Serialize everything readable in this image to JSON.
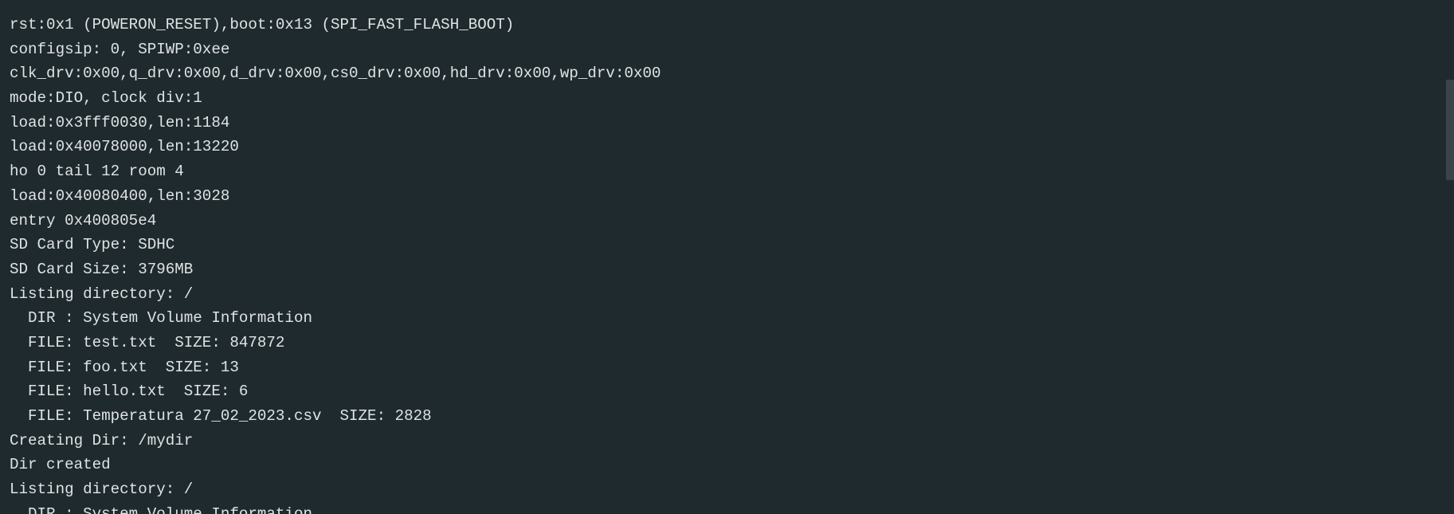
{
  "serial_monitor": {
    "lines": [
      "rst:0x1 (POWERON_RESET),boot:0x13 (SPI_FAST_FLASH_BOOT)",
      "configsip: 0, SPIWP:0xee",
      "clk_drv:0x00,q_drv:0x00,d_drv:0x00,cs0_drv:0x00,hd_drv:0x00,wp_drv:0x00",
      "mode:DIO, clock div:1",
      "load:0x3fff0030,len:1184",
      "load:0x40078000,len:13220",
      "ho 0 tail 12 room 4",
      "load:0x40080400,len:3028",
      "entry 0x400805e4",
      "SD Card Type: SDHC",
      "SD Card Size: 3796MB",
      "Listing directory: /",
      "  DIR : System Volume Information",
      "  FILE: test.txt  SIZE: 847872",
      "  FILE: foo.txt  SIZE: 13",
      "  FILE: hello.txt  SIZE: 6",
      "  FILE: Temperatura 27_02_2023.csv  SIZE: 2828",
      "Creating Dir: /mydir",
      "Dir created",
      "Listing directory: /",
      "  DIR : System Volume Information"
    ]
  },
  "colors": {
    "background": "#1f2a2e",
    "text": "#dfe3e4",
    "scrollbar_thumb": "#3b4448"
  }
}
